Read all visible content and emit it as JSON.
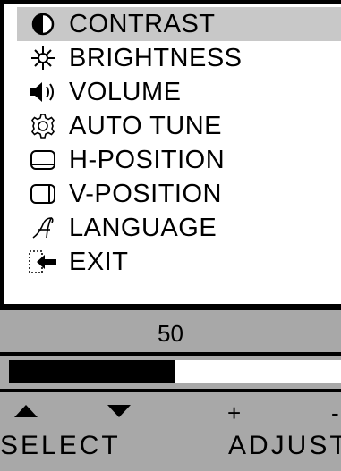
{
  "menu": {
    "selected_index": 0,
    "items": [
      {
        "label": "CONTRAST",
        "icon": "contrast-icon"
      },
      {
        "label": "BRIGHTNESS",
        "icon": "brightness-icon"
      },
      {
        "label": "VOLUME",
        "icon": "volume-icon"
      },
      {
        "label": "AUTO TUNE",
        "icon": "gear-icon"
      },
      {
        "label": "H-POSITION",
        "icon": "h-position-icon"
      },
      {
        "label": "V-POSITION",
        "icon": "v-position-icon"
      },
      {
        "label": "LANGUAGE",
        "icon": "language-icon"
      },
      {
        "label": "EXIT",
        "icon": "exit-icon"
      }
    ]
  },
  "adjust": {
    "value": "50",
    "level_fraction": 0.5
  },
  "controls": {
    "select_label": "SELECT",
    "adjust_label": "ADJUST",
    "plus_symbol": "+",
    "minus_symbol": "-"
  },
  "colors": {
    "selection": "#c8c8c8",
    "panel": "#a8a8a8",
    "bar": "#000000"
  }
}
